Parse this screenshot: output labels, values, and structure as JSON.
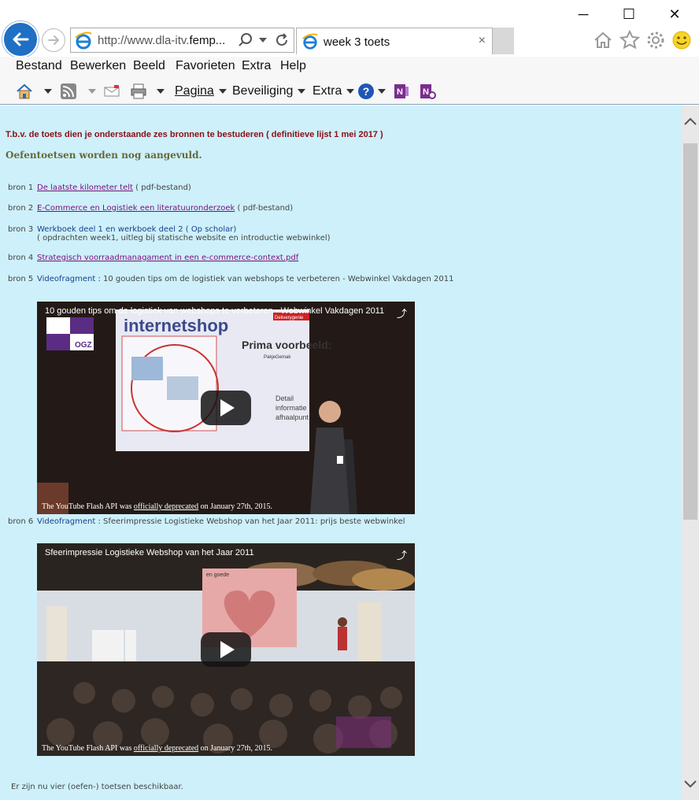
{
  "window": {
    "minimize": "─",
    "maximize": "☐",
    "close": "✕"
  },
  "address": {
    "url_prefix": "http://www.dla-itv.",
    "url_domain": "femp...",
    "tab_title": "week 3 toets",
    "tab_close": "×"
  },
  "menu": {
    "items": [
      "Bestand",
      "Bewerken",
      "Beeld",
      "Favorieten",
      "Extra",
      "Help"
    ]
  },
  "commandbar": {
    "pagina": "Pagina",
    "beveiliging": "Beveiliging",
    "extra": "Extra"
  },
  "content": {
    "intro": "T.b.v. de toets dien je onderstaande zes bronnen te bestuderen ( definitieve lijst  1 mei 2017  )",
    "practice": "Oefentoetsen worden nog aangevuld.",
    "sources": [
      {
        "label": "bron 1",
        "link": "De laatste kilometer telt",
        "note": " ( pdf-bestand)"
      },
      {
        "label": "bron 2",
        "link": "E-Commerce en Logistiek  een literatuuronderzoek",
        "note": " ( pdf-bestand)"
      },
      {
        "label": "bron 3",
        "text": "Werkboek deel 1 en werkboek deel 2 ( Op scholar)",
        "sub": "( opdrachten week1, uitleg bij statische website en introductie webwinkel)"
      },
      {
        "label": "bron 4",
        "link": "Strategisch voorraadmanagament in een e-commerce-context.pdf"
      },
      {
        "label": "bron 5",
        "prefix": "Videofragment :",
        "text": " 10 gouden tips om de logistiek van webshops te verbeteren - Webwinkel Vakdagen 2011"
      },
      {
        "label": "bron 6",
        "prefix": "Videofragment :",
        "text": " Sfeerimpressie Logistieke Webshop van het Jaar 2011: prijs beste webwinkel"
      }
    ],
    "videos": [
      {
        "title": "10 gouden tips om de logistiek van webshops te verbeteren - Webwinkel Vakdagen 2011"
      },
      {
        "title": "Sfeerimpressie Logistieke Webshop van het Jaar 2011"
      }
    ],
    "video_note_prefix": "The YouTube Flash API was ",
    "video_note_link": "officially deprecated",
    "video_note_suffix": " on January 27th, 2015.",
    "footer": "Er zijn nu vier  (oefen-) toetsen beschikbaar.",
    "video1_slide": {
      "brand": "internetshop",
      "heading": "Prima voorbeeld:",
      "brand2": "PakjeGemak",
      "lines": [
        "Detail",
        "informatie",
        "afhaalpunt"
      ],
      "logo": "OGZ",
      "badge": "Deliverygenie"
    },
    "video2_slide": {
      "caption": "en goede"
    }
  },
  "colors": {
    "content_bg": "#cdf0fa",
    "intro": "#8b0f16",
    "link": "#7a0f7a",
    "accent_blue": "#1a3f8c"
  }
}
